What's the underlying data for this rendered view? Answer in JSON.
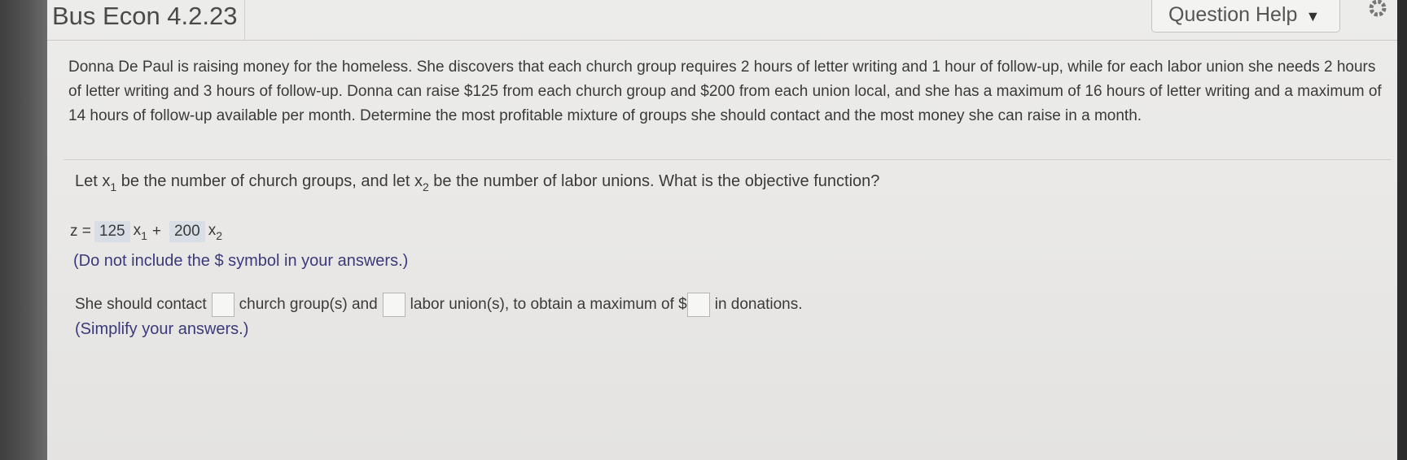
{
  "header": {
    "title": "Bus Econ 4.2.23",
    "help_label": "Question Help",
    "help_caret": "▼"
  },
  "problem_text": "Donna De Paul is raising money for the homeless. She discovers that each church group requires 2 hours of letter writing and 1 hour of follow-up, while for each labor union she needs 2 hours of letter writing and 3 hours of follow-up. Donna can raise $125 from each church group and $200 from each union local, and she has a maximum of 16 hours of letter writing and a maximum of 14 hours of follow-up available per month. Determine the most profitable mixture of groups she should contact and the most money she can raise in a month.",
  "question": {
    "part1": "Let x",
    "sub1": "1",
    "part2": " be the number of church groups, and let x",
    "sub2": "2",
    "part3": " be the number of labor unions. What is the objective function?"
  },
  "objective": {
    "prefix": "z =",
    "coef1": "125",
    "var1": "x",
    "sub1": "1",
    "plus": "+",
    "coef2": "200",
    "var2": "x",
    "sub2": "2"
  },
  "note1": "(Do not include the $ symbol in your answers.)",
  "answer": {
    "text1": "She should contact",
    "text2": "church group(s) and",
    "text3": "labor union(s), to obtain a maximum of $",
    "text4": "in donations."
  },
  "note2": "(Simplify your answers.)"
}
